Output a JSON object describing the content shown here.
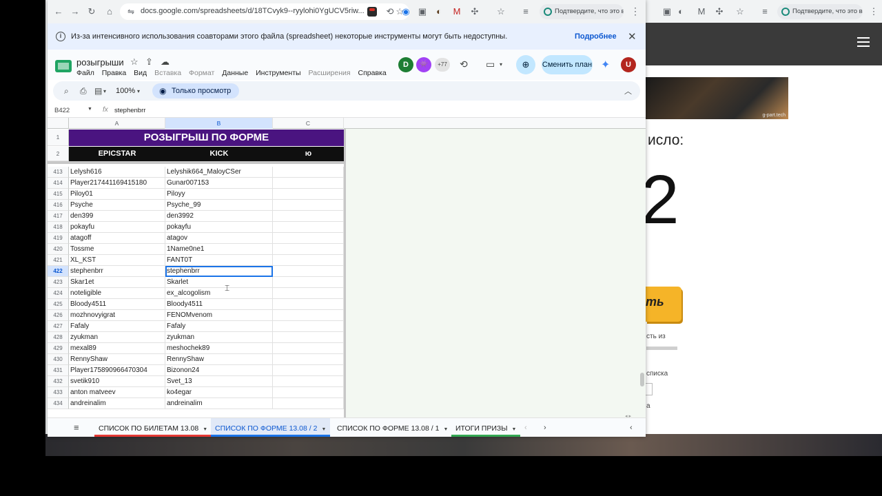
{
  "browser": {
    "url": "docs.google.com/spreadsheets/d/18TCvyk9--ryylohi0YgUCV5riw...",
    "verify_label": "Подтвердите, что это вы",
    "ext_badge": "26"
  },
  "notice": {
    "text": "Из-за интенсивного использования соавторами этого файла (spreadsheet) некоторые инструменты могут быть недоступны.",
    "more": "Подробнее",
    "close": "✕"
  },
  "doc": {
    "title": "розыгрыши",
    "menu": [
      "Файл",
      "Правка",
      "Вид",
      "Вставка",
      "Формат",
      "Данные",
      "Инструменты",
      "Расширения",
      "Справка"
    ],
    "menu_dimmed": [
      false,
      false,
      false,
      true,
      true,
      false,
      false,
      true,
      false
    ],
    "avatars": [
      {
        "letter": "D",
        "color": "#1e7e34"
      },
      {
        "letter": "👾",
        "color": "#a142f4"
      },
      {
        "letter": "U",
        "color": "#b3261e"
      }
    ],
    "more_collaborators": "+77",
    "plan_button": "Сменить план"
  },
  "toolbar": {
    "zoom": "100%",
    "view_only": "Только просмотр"
  },
  "formula_bar": {
    "cell_ref": "B422",
    "fx": "fx",
    "value": "stephenbrr"
  },
  "sheet": {
    "columns": [
      "A",
      "B",
      "C"
    ],
    "selected_column": "B",
    "title_row_num": "1",
    "header_row_num": "2",
    "title": "РОЗЫГРЫШ ПО ФОРМЕ",
    "headers": [
      "EPICSTAR",
      "KICK",
      "ю"
    ],
    "active_row": "422",
    "rows": [
      {
        "num": "413",
        "a": "Lelysh616",
        "b": "Lelyshik664_MaloyCSer",
        "c": ""
      },
      {
        "num": "414",
        "a": "Player217441169415180",
        "b": "Gunar007153",
        "c": ""
      },
      {
        "num": "415",
        "a": "Piloy01",
        "b": "Piloyy",
        "c": ""
      },
      {
        "num": "416",
        "a": "Psyche",
        "b": "Psyche_99",
        "c": ""
      },
      {
        "num": "417",
        "a": "den399",
        "b": "den3992",
        "c": ""
      },
      {
        "num": "418",
        "a": "pokayfu",
        "b": "pokayfu",
        "c": ""
      },
      {
        "num": "419",
        "a": "atagoff",
        "b": "atagov",
        "c": ""
      },
      {
        "num": "420",
        "a": "Tossme",
        "b": "1Name0ne1",
        "c": ""
      },
      {
        "num": "421",
        "a": "XL_KST",
        "b": "FANT0T",
        "c": ""
      },
      {
        "num": "422",
        "a": "stephenbrr",
        "b": "stephenbrr",
        "c": ""
      },
      {
        "num": "423",
        "a": "Skar1et",
        "b": "Skarlet",
        "c": ""
      },
      {
        "num": "424",
        "a": "noteligible",
        "b": "ex_alcogolism",
        "c": ""
      },
      {
        "num": "425",
        "a": "Bloody4511",
        "b": "Bloody4511",
        "c": ""
      },
      {
        "num": "426",
        "a": "mozhnovyigrat",
        "b": "FENOMvenom",
        "c": ""
      },
      {
        "num": "427",
        "a": "Fafaly",
        "b": "Fafaly",
        "c": ""
      },
      {
        "num": "428",
        "a": "zyukman",
        "b": "zyukman",
        "c": ""
      },
      {
        "num": "429",
        "a": "mexal89",
        "b": "meshochek89",
        "c": ""
      },
      {
        "num": "430",
        "a": "RennyShaw",
        "b": "RennyShaw",
        "c": ""
      },
      {
        "num": "431",
        "a": "Player175890966470304",
        "b": "Bizonon24",
        "c": ""
      },
      {
        "num": "432",
        "a": "svetik910",
        "b": "Svet_13",
        "c": ""
      },
      {
        "num": "433",
        "a": "anton matveev",
        "b": "ko4egar",
        "c": ""
      },
      {
        "num": "434",
        "a": "andreinalim",
        "b": "andreinalim",
        "c": ""
      }
    ]
  },
  "sheet_tabs": [
    {
      "label": "СПИСОК ПО БИЛЕТАМ 13.08",
      "color": "#e53935",
      "active": false
    },
    {
      "label": "СПИСОК ПО ФОРМЕ 13.08 / 2",
      "color": "#1a73e8",
      "active": true
    },
    {
      "label": "СПИСОК ПО ФОРМЕ 13.08 / 1",
      "color": "",
      "active": false
    },
    {
      "label": "ИТОГИ ПРИЗЫ",
      "color": "#34a853",
      "active": false
    }
  ],
  "background_page": {
    "banner_tag": "g-part.tech",
    "heading_fragment": "исло:",
    "big_number": "2",
    "button_fragment": "ть",
    "text_fragment_1": "сть из",
    "text_fragment_2": "списка",
    "text_fragment_3": "а"
  }
}
